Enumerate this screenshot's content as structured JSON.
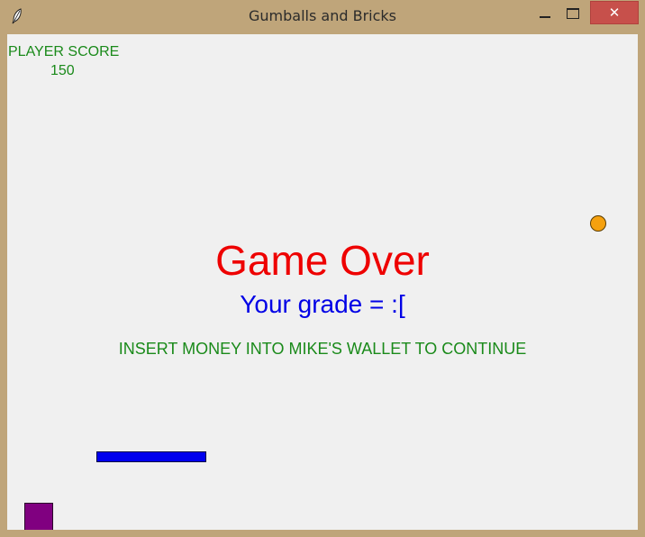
{
  "window": {
    "title": "Gumballs and Bricks",
    "icons": {
      "app": "feather-icon",
      "minimize": "minimize-icon",
      "maximize": "maximize-icon",
      "close": "close-icon"
    },
    "close_glyph": "✕",
    "colors": {
      "frame": "#bfa57a",
      "close_button": "#c7504b"
    }
  },
  "game": {
    "score_label": "PLAYER SCORE",
    "score_value": "150",
    "game_over": "Game Over",
    "grade": "Your grade = :[",
    "continue_message": "INSERT MONEY INTO MIKE'S WALLET TO CONTINUE",
    "colors": {
      "background": "#f0f0f0",
      "score_text": "#1a8a1a",
      "game_over_text": "#ee0000",
      "grade_text": "#0000e6",
      "message_text": "#1a8a1a",
      "ball": "#f5a10f",
      "paddle": "#0000ee",
      "square": "#800080"
    }
  }
}
